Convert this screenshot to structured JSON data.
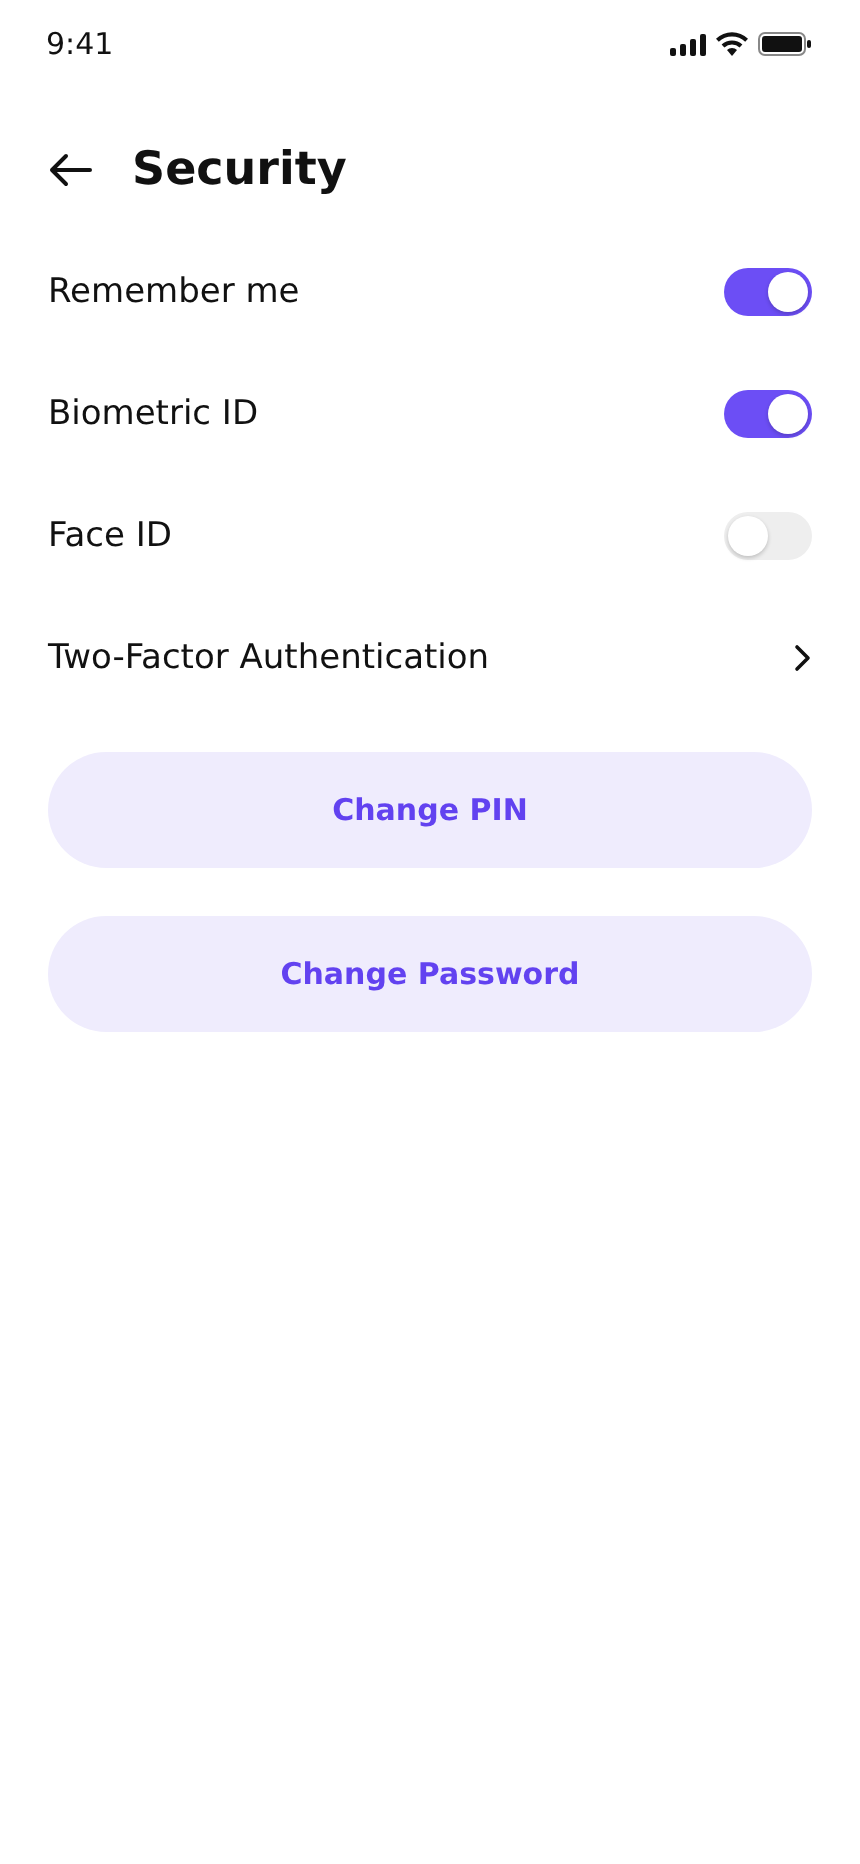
{
  "status_bar": {
    "time": "9:41"
  },
  "header": {
    "title": "Security"
  },
  "settings": [
    {
      "kind": "toggle",
      "label": "Remember me",
      "on": true
    },
    {
      "kind": "toggle",
      "label": "Biometric ID",
      "on": true
    },
    {
      "kind": "toggle",
      "label": "Face ID",
      "on": false
    },
    {
      "kind": "link",
      "label": "Two-Factor Authentication"
    }
  ],
  "buttons": [
    "Change PIN",
    "Change Password"
  ]
}
